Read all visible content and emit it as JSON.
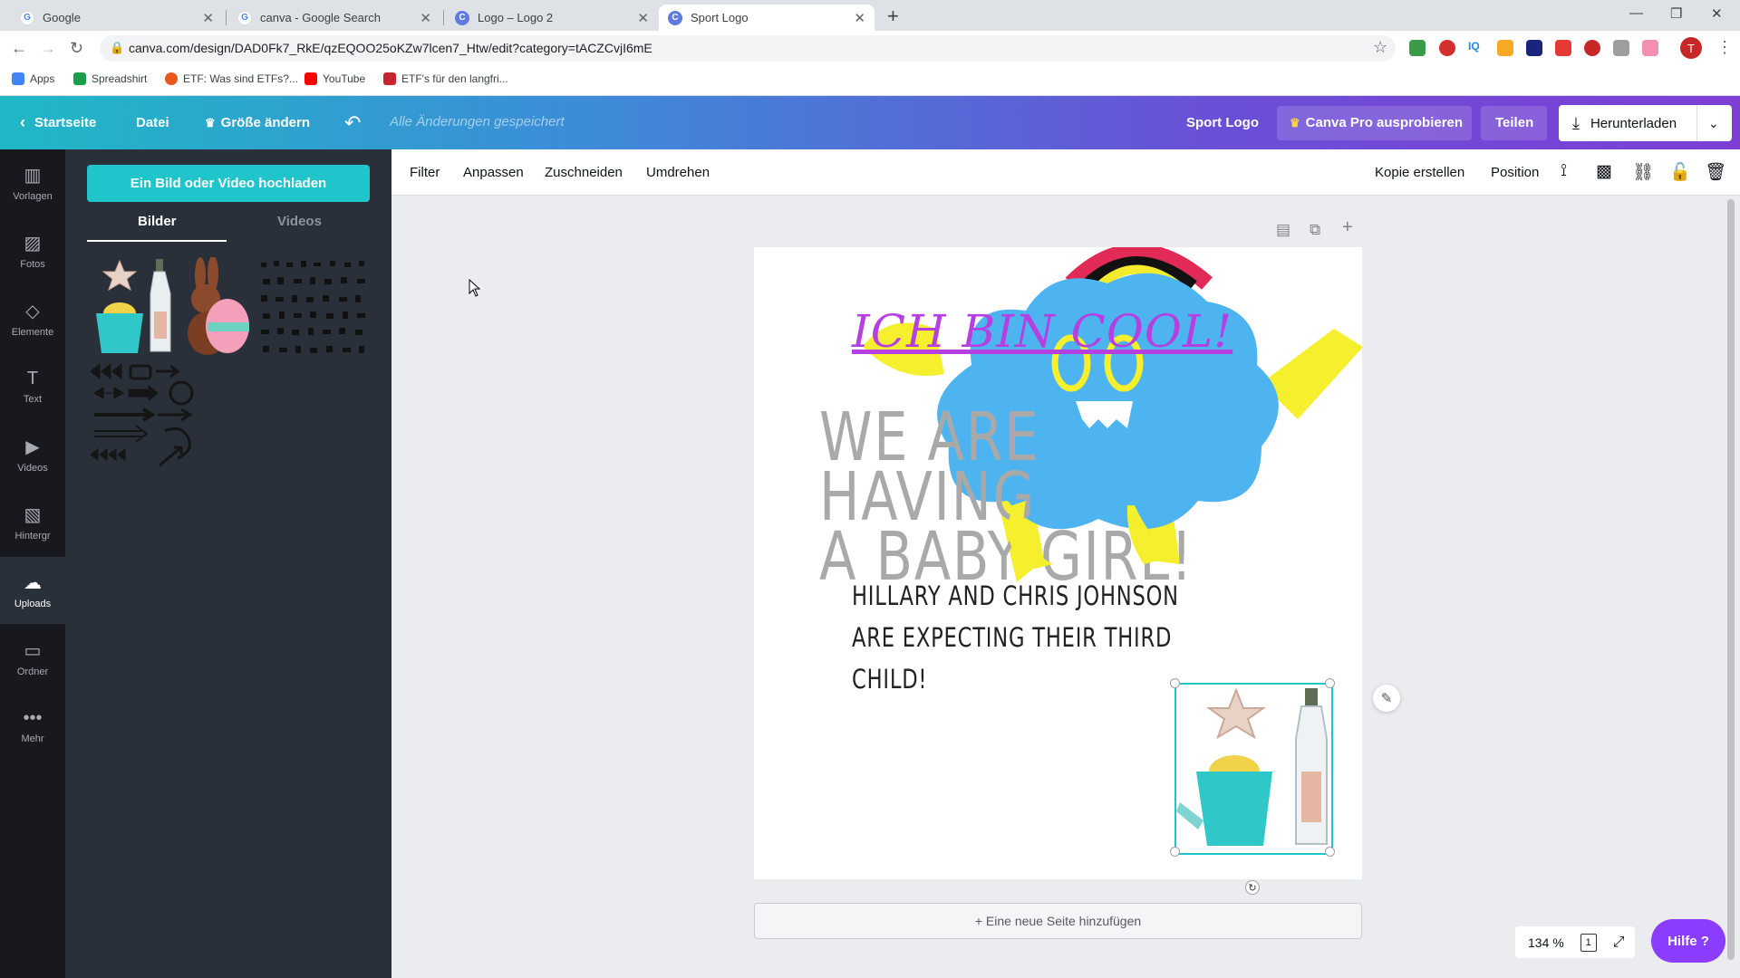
{
  "browser": {
    "tabs": [
      {
        "title": "Google",
        "favicon": "google-icon"
      },
      {
        "title": "canva - Google Search",
        "favicon": "google-icon"
      },
      {
        "title": "Logo – Logo 2",
        "favicon": "canva-icon"
      },
      {
        "title": "Sport Logo",
        "favicon": "canva-icon"
      }
    ],
    "active_tab": 3,
    "url": "canva.com/design/DAD0Fk7_RkE/qzEQOO25oKZw7lcen7_Htw/edit?category=tACZCvjI6mE",
    "bookmarks": [
      {
        "label": "Apps",
        "color": "#4285f4"
      },
      {
        "label": "Spreadshirt",
        "color": "#1a9e4a"
      },
      {
        "label": "ETF: Was sind ETFs?...",
        "color": "#e8571c"
      },
      {
        "label": "YouTube",
        "color": "#ff0000"
      },
      {
        "label": "ETF's für den langfri...",
        "color": "#c5252c"
      }
    ],
    "profile_initial": "T"
  },
  "header": {
    "back_label": "Startseite",
    "file_label": "Datei",
    "resize_label": "Größe ändern",
    "saved_status": "Alle Änderungen gespeichert",
    "design_name": "Sport Logo",
    "pro_label": "Canva Pro ausprobieren",
    "share_label": "Teilen",
    "download_label": "Herunterladen"
  },
  "rail": [
    {
      "label": "Vorlagen",
      "icon": "template-icon"
    },
    {
      "label": "Fotos",
      "icon": "photo-icon"
    },
    {
      "label": "Elemente",
      "icon": "shapes-icon"
    },
    {
      "label": "Text",
      "icon": "text-icon"
    },
    {
      "label": "Videos",
      "icon": "video-icon"
    },
    {
      "label": "Hintergr",
      "icon": "background-icon"
    },
    {
      "label": "Uploads",
      "icon": "upload-icon"
    },
    {
      "label": "Ordner",
      "icon": "folder-icon"
    },
    {
      "label": "Mehr",
      "icon": "more-icon"
    }
  ],
  "rail_active": "Uploads",
  "panel": {
    "upload_button": "Ein Bild oder Video hochladen",
    "tabs": [
      "Bilder",
      "Videos"
    ],
    "active_tab": "Bilder",
    "thumbnails": [
      "beach-items",
      "easter-bunny",
      "black-silhouettes",
      "black-arrows"
    ]
  },
  "toolbar": {
    "left": [
      "Filter",
      "Anpassen",
      "Zuschneiden",
      "Umdrehen"
    ],
    "copy_label": "Kopie erstellen",
    "position_label": "Position",
    "icons": [
      "paint-roller-icon",
      "transparency-icon",
      "link-icon",
      "lock-icon",
      "trash-icon"
    ]
  },
  "design": {
    "headline": "ICH BIN COOL!",
    "big_lines": [
      "WE ARE",
      "HAVING",
      "A BABY GIRL!"
    ],
    "sub_lines": [
      "HILLARY AND CHRIS JOHNSON",
      "ARE EXPECTING THEIR THIRD",
      "CHILD!"
    ],
    "colors": {
      "headline": "#b53fe0",
      "big": "#a9a9a9",
      "cloud": "#4db4f0",
      "monster_arms": "#f5ef2e"
    }
  },
  "add_page_label": "+ Eine neue Seite hinzufügen",
  "zoom": {
    "value": "134 %",
    "page": "1"
  },
  "help_label": "Hilfe ?"
}
